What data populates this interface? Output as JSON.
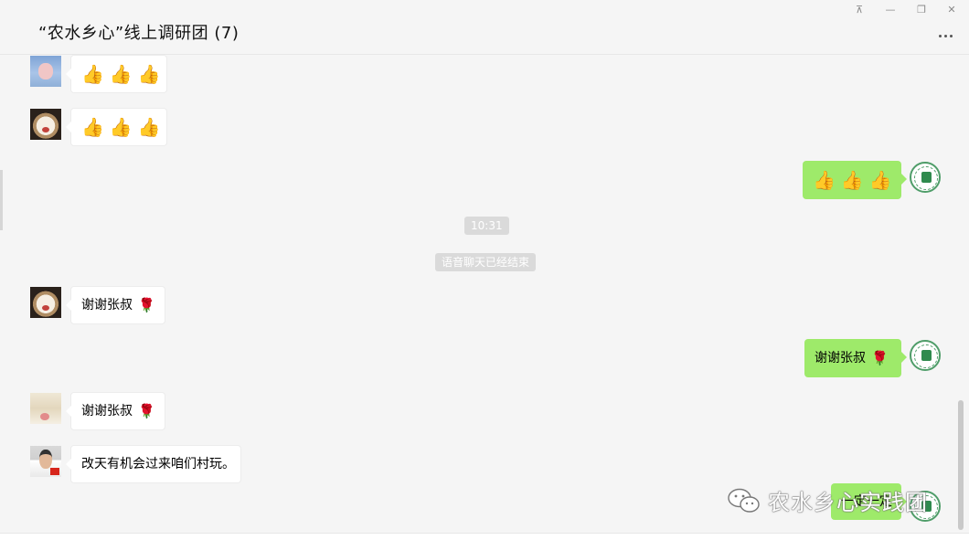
{
  "window": {
    "title": "“农水乡心”线上调研团 (7)",
    "controls": {
      "pin": "⊼",
      "minimize": "—",
      "maximize": "❐",
      "close": "✕"
    }
  },
  "messages": [
    {
      "direction": "incoming",
      "avatar": "pig-avatar",
      "content": "👍👍👍"
    },
    {
      "direction": "incoming",
      "avatar": "dog-avatar",
      "content": "👍👍👍"
    },
    {
      "direction": "outgoing",
      "avatar": "logo-avatar",
      "content": "👍👍👍"
    },
    {
      "direction": "system",
      "content": "10:31"
    },
    {
      "direction": "system",
      "content": "语音聊天已经结束"
    },
    {
      "direction": "incoming",
      "avatar": "dog-avatar",
      "content": "谢谢张叔",
      "emoji": "🌹"
    },
    {
      "direction": "outgoing",
      "avatar": "logo-avatar",
      "content": "谢谢张叔",
      "emoji": "🌹"
    },
    {
      "direction": "incoming",
      "avatar": "cats-avatar",
      "content": "谢谢张叔",
      "emoji": "🌹"
    },
    {
      "direction": "incoming",
      "avatar": "man-avatar",
      "content": "改天有机会过来咱们村玩。"
    },
    {
      "direction": "outgoing",
      "avatar": "logo-avatar",
      "content": "一定一定"
    }
  ],
  "watermark": {
    "text": "农水乡心实践团",
    "icon": "wechat-icon"
  },
  "colors": {
    "outgoing_bubble": "#9eea6a",
    "incoming_bubble": "#ffffff",
    "background": "#f5f5f5"
  }
}
